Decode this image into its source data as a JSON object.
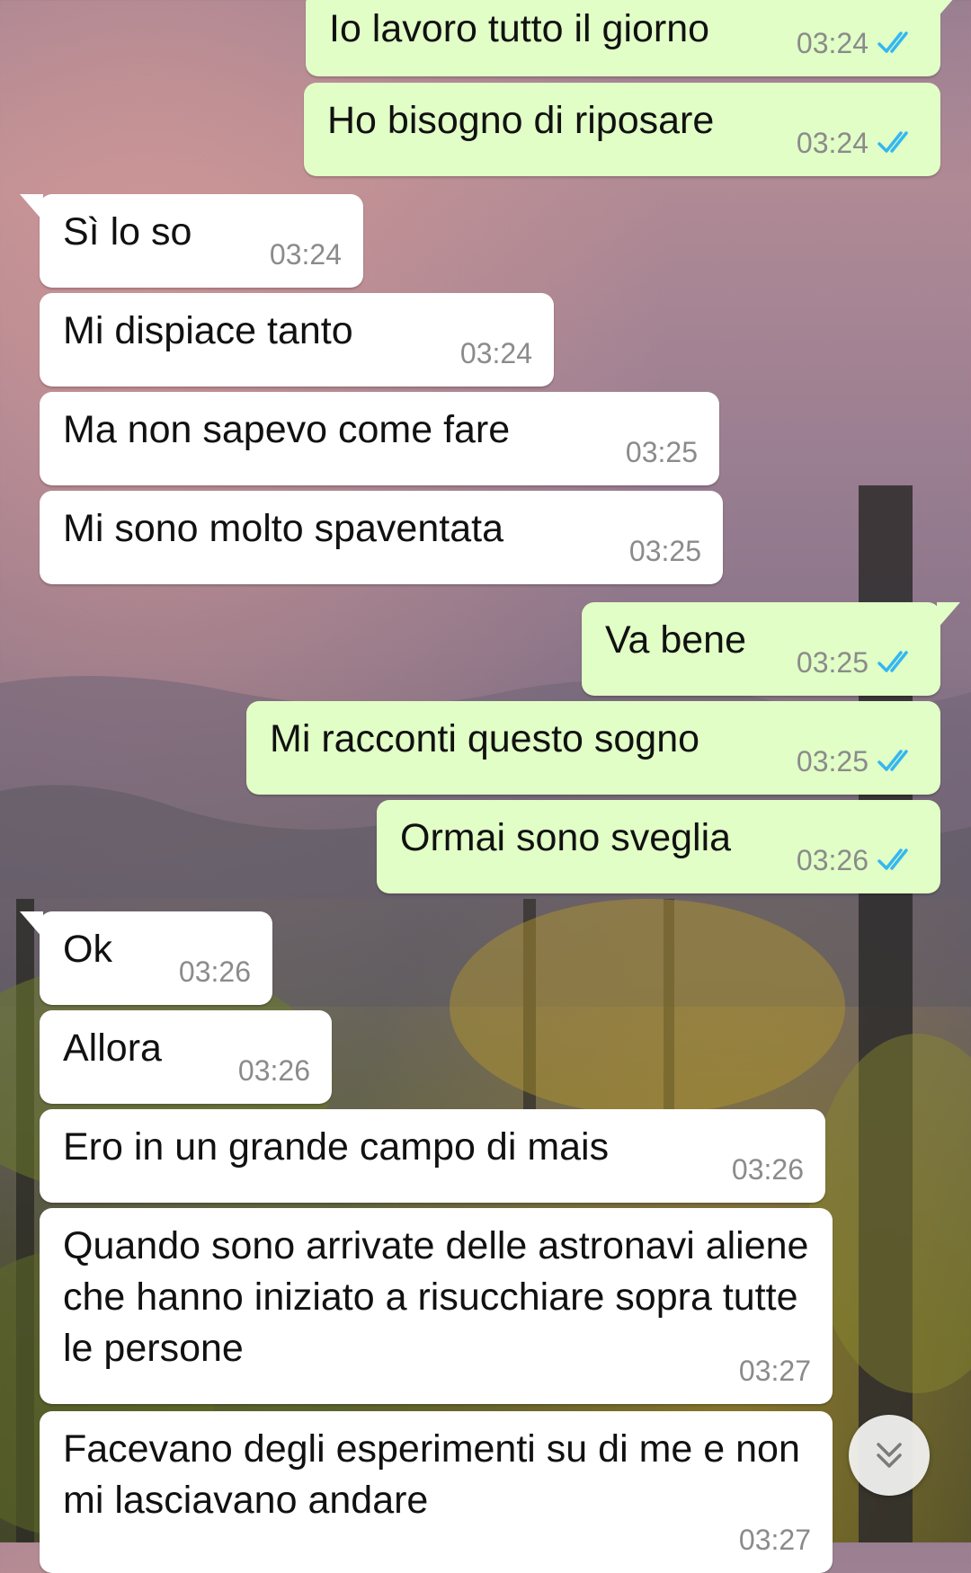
{
  "messages": [
    {
      "dir": "out",
      "text": "Io lavoro tutto il giorno",
      "time": "03:24"
    },
    {
      "dir": "out",
      "text": "Ho bisogno di riposare",
      "time": "03:24"
    },
    {
      "dir": "in",
      "text": "Sì lo so",
      "time": "03:24"
    },
    {
      "dir": "in",
      "text": "Mi dispiace tanto",
      "time": "03:24"
    },
    {
      "dir": "in",
      "text": "Ma non sapevo come fare",
      "time": "03:25"
    },
    {
      "dir": "in",
      "text": "Mi sono molto spaventata",
      "time": "03:25"
    },
    {
      "dir": "out",
      "text": "Va bene",
      "time": "03:25"
    },
    {
      "dir": "out",
      "text": "Mi racconti questo sogno",
      "time": "03:25"
    },
    {
      "dir": "out",
      "text": "Ormai sono sveglia",
      "time": "03:26"
    },
    {
      "dir": "in",
      "text": "Ok",
      "time": "03:26"
    },
    {
      "dir": "in",
      "text": "Allora",
      "time": "03:26"
    },
    {
      "dir": "in",
      "text": "Ero in un grande campo di mais",
      "time": "03:26"
    },
    {
      "dir": "in",
      "text": "Quando sono arrivate delle astronavi aliene che hanno iniziato a risucchiare sopra tutte le persone",
      "time": "03:27"
    },
    {
      "dir": "in",
      "text": "Facevano degli esperimenti su di me e non mi lasciavano andare",
      "time": "03:27"
    }
  ],
  "colors": {
    "incoming_bubble": "#ffffff",
    "outgoing_bubble": "#e1fec6",
    "read_ticks": "#34b7f1",
    "timestamp": "#8b8b8b"
  },
  "icons": {
    "read_receipt": "double-check-icon",
    "scroll_down": "double-chevron-down-icon"
  }
}
